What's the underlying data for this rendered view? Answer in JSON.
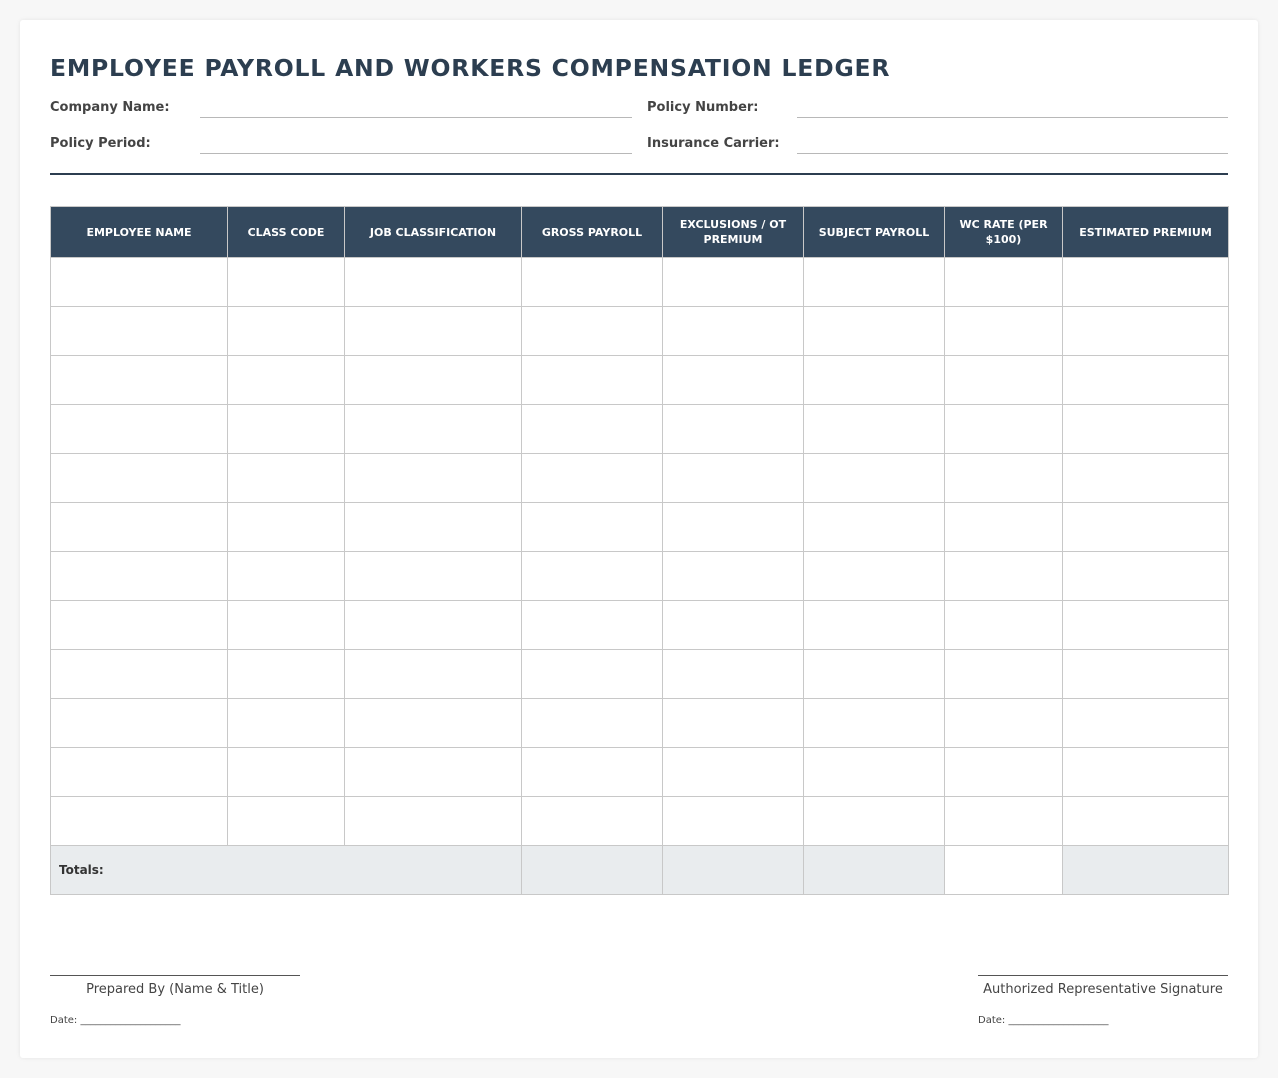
{
  "title": "EMPLOYEE PAYROLL AND WORKERS COMPENSATION LEDGER",
  "fields": {
    "company_name": "Company Name:",
    "policy_number": "Policy Number:",
    "policy_period": "Policy Period:",
    "insurance_carrier": "Insurance Carrier:"
  },
  "table": {
    "headers": [
      "EMPLOYEE NAME",
      "CLASS CODE",
      "JOB CLASSIFICATION",
      "GROSS PAYROLL",
      "EXCLUSIONS / OT PREMIUM",
      "SUBJECT PAYROLL",
      "WC RATE (PER $100)",
      "ESTIMATED PREMIUM"
    ],
    "empty_rows": 12,
    "totals_label": "Totals:"
  },
  "signatures": {
    "left_caption": "Prepared By (Name & Title)",
    "right_caption": "Authorized Representative Signature",
    "date_label": "Date: ____________________"
  },
  "colors": {
    "header_bg": "#34495e",
    "title": "#2c3e50",
    "totals_bg": "#e9ecee"
  }
}
